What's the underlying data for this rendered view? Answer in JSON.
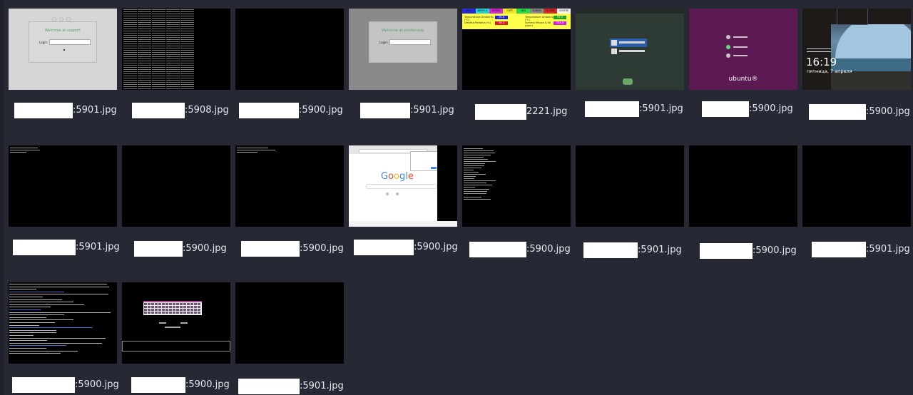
{
  "gallery": {
    "items": [
      {
        "kind": "login-light",
        "login_title": "Welcome at support",
        "login_label": "Login:",
        "file_suffix": ":5901.jpg"
      },
      {
        "kind": "terminal-dense",
        "file_suffix": ":5908.jpg"
      },
      {
        "kind": "black",
        "file_suffix": ":5900.jpg"
      },
      {
        "kind": "login-dark",
        "login_title": "Welcome at printercody",
        "login_label": "Login:",
        "file_suffix": ":5901.jpg"
      },
      {
        "kind": "dashboard",
        "headers": [
          "NEO",
          "NEPIFLA",
          "MERKA",
          "CUPI",
          "LMO",
          "SUBSIN",
          "ALUMNI",
          "CENTRE"
        ],
        "header_colors": [
          "#2a2bd8",
          "#2bd3d8",
          "#d82bd0",
          "#f0e62b",
          "#2bd84a",
          "#8a8a8a",
          "#d82b2b",
          "#f4f4f4"
        ],
        "rows": [
          {
            "label": "Temperature Ambients (°C)",
            "value": "26.8",
            "right_label": "Temperature Ambiens (°C)",
            "right_value": "55.5"
          },
          {
            "label": "Umidità Relativa (%)",
            "value": "36.3",
            "right_label": "Somma Misura 0.56 (ppm)",
            "right_value": "734.3"
          }
        ],
        "value_colors": [
          "#2020d8",
          "#d82020",
          "#20a020",
          "#d820d8"
        ],
        "file_suffix": "2221.jpg"
      },
      {
        "kind": "suse",
        "file_suffix": ":5901.jpg"
      },
      {
        "kind": "ubuntu",
        "brand": "ubuntu®",
        "file_suffix": ":5900.jpg"
      },
      {
        "kind": "windows",
        "time": "16:19",
        "date": "пятница, 7 апреля",
        "file_suffix": ":5900.jpg"
      },
      {
        "kind": "terminal-sparse",
        "file_suffix": ":5901.jpg"
      },
      {
        "kind": "black",
        "file_suffix": ":5900.jpg"
      },
      {
        "kind": "terminal-sparse2",
        "file_suffix": ":5900.jpg"
      },
      {
        "kind": "google",
        "brand": "Google",
        "file_suffix": ":5900.jpg"
      },
      {
        "kind": "terminal-log",
        "file_suffix": ":5900.jpg"
      },
      {
        "kind": "black",
        "file_suffix": ":5901.jpg"
      },
      {
        "kind": "black",
        "file_suffix": ":5900.jpg"
      },
      {
        "kind": "black",
        "file_suffix": ":5901.jpg"
      },
      {
        "kind": "dmesg",
        "file_suffix": ":5900.jpg"
      },
      {
        "kind": "keyboard",
        "file_suffix": ":5900.jpg"
      },
      {
        "kind": "black",
        "file_suffix": ":5901.jpg"
      }
    ]
  }
}
